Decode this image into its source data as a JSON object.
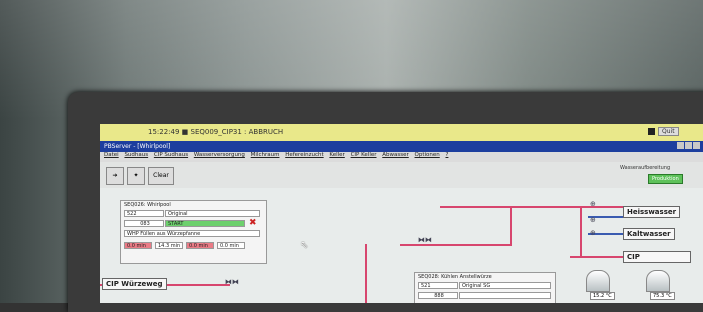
{
  "status_bar": {
    "message": "15:22:49  ■  SEQ009_CIP31 : ABBRUCH",
    "quit_label": "Quit"
  },
  "window": {
    "title": "PBServer - [Whirlpool]"
  },
  "menu": [
    "Datei",
    "Sudhaus",
    "CIP Sudhaus",
    "Wasserversorgung",
    "Milchraum",
    "Hefereinzucht",
    "Keller",
    "CIP Keller",
    "Abwasser",
    "Optionen",
    "?"
  ],
  "toolbar": {
    "clear_label": "Clear",
    "area_label": "Wasseraufbereitung",
    "production_badge": "Produktion"
  },
  "whirlpool": {
    "title": "SEQ026: Whirlpool",
    "code": "522",
    "recipe": "Original",
    "step_no": "083",
    "step_state": "START",
    "step_text": "WHP Füllen aus Würzepfanne",
    "timers": [
      "0.0 min",
      "14.3 min",
      "0.0 min",
      "0.0 min"
    ]
  },
  "cooling": {
    "title": "SEQ028: Kühlen Anstellwürze",
    "code": "521",
    "recipe": "Original SG",
    "step_no": "888"
  },
  "targets": {
    "hot": "Heisswasser",
    "cold": "Kaltwasser",
    "cip": "CIP",
    "cip_route": "CIP Würzeweg"
  },
  "tanks": {
    "left_value": "15.2 °C",
    "right_value": "75.3 °C"
  },
  "colors": {
    "pipe": "#d7466e",
    "status_bar": "#e9e88a",
    "title_bar": "#1d3e9e"
  }
}
